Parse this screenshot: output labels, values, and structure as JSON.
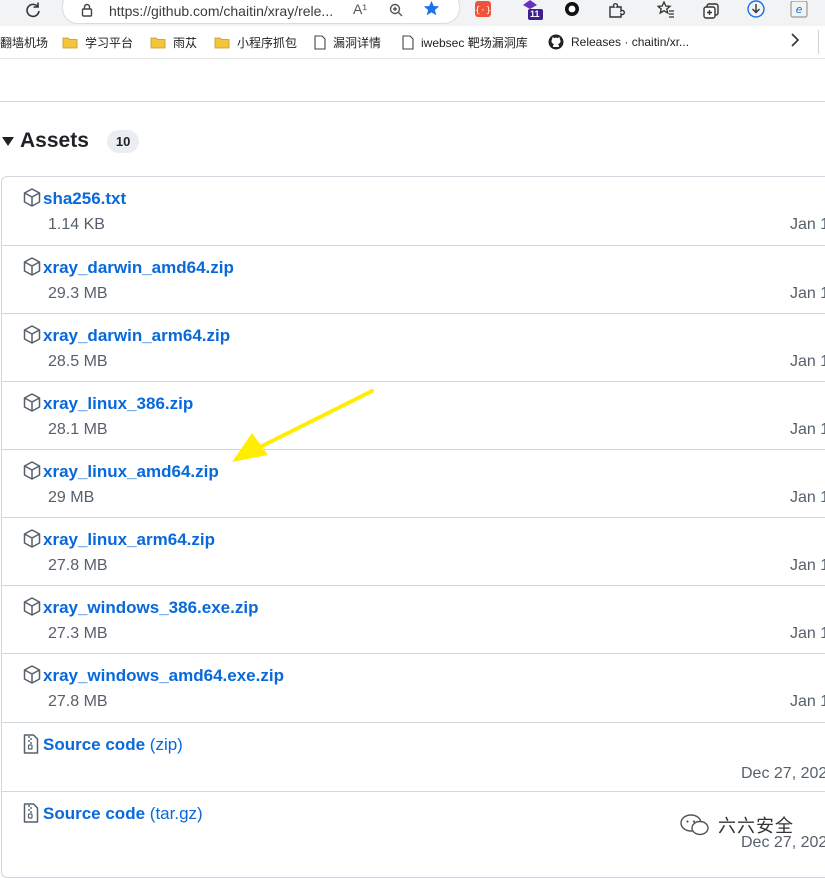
{
  "browser": {
    "url": "https://github.com/chaitin/xray/rele...",
    "read_aloud_glyph": "A¹",
    "extension_badge": "11"
  },
  "bookmarks": [
    {
      "label": "翻墙机场",
      "icon": "folder-icon"
    },
    {
      "label": "学习平台",
      "icon": "folder-icon"
    },
    {
      "label": "雨苁",
      "icon": "folder-icon"
    },
    {
      "label": "小程序抓包",
      "icon": "folder-icon"
    },
    {
      "label": "漏洞详情",
      "icon": "page-icon"
    },
    {
      "label": "iwebsec 靶场漏洞库",
      "icon": "page-icon"
    },
    {
      "label": "Releases · chaitin/xr...",
      "icon": "github-icon"
    }
  ],
  "assets": {
    "title": "Assets",
    "count": "10",
    "items": [
      {
        "name": "sha256.txt",
        "size": "1.14 KB",
        "date": "Jan 1"
      },
      {
        "name": "xray_darwin_amd64.zip",
        "size": "29.3 MB",
        "date": "Jan 1"
      },
      {
        "name": "xray_darwin_arm64.zip",
        "size": "28.5 MB",
        "date": "Jan 1"
      },
      {
        "name": "xray_linux_386.zip",
        "size": "28.1 MB",
        "date": "Jan 1"
      },
      {
        "name": "xray_linux_amd64.zip",
        "size": "29 MB",
        "date": "Jan 1"
      },
      {
        "name": "xray_linux_arm64.zip",
        "size": "27.8 MB",
        "date": "Jan 1"
      },
      {
        "name": "xray_windows_386.exe.zip",
        "size": "27.3 MB",
        "date": "Jan 1"
      },
      {
        "name": "xray_windows_amd64.exe.zip",
        "size": "27.8 MB",
        "date": "Jan 1"
      },
      {
        "name": "Source code",
        "ext": "(zip)",
        "size": "",
        "date": "Dec 27, 202"
      },
      {
        "name": "Source code",
        "ext": "(tar.gz)",
        "size": "",
        "date": "Dec 27, 202"
      }
    ]
  },
  "watermark": "六六安全",
  "colors": {
    "link": "#0969da",
    "arrow": "#ffee00",
    "muted": "#57606a"
  }
}
